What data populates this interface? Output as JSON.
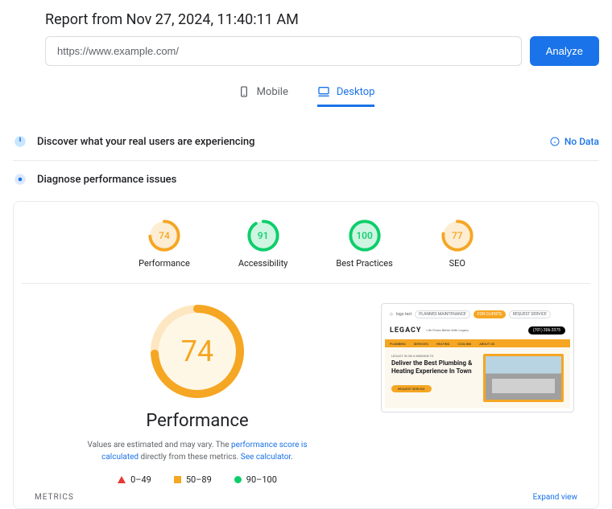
{
  "report_title": "Report from Nov 27, 2024, 11:40:11 AM",
  "url_value": "https://www.example.com/",
  "analyze_label": "Analyze",
  "tabs": {
    "mobile": "Mobile",
    "desktop": "Desktop"
  },
  "sections": {
    "discover": "Discover what your real users are experiencing",
    "no_data": "No Data",
    "diagnose": "Diagnose performance issues"
  },
  "scores": [
    {
      "value": 74,
      "label": "Performance",
      "color": "#f5a623"
    },
    {
      "value": 91,
      "label": "Accessibility",
      "color": "#0cce6b"
    },
    {
      "value": 100,
      "label": "Best Practices",
      "color": "#0cce6b"
    },
    {
      "value": 77,
      "label": "SEO",
      "color": "#f5a623"
    }
  ],
  "big_score": {
    "value": 74,
    "label": "Performance",
    "color": "#f5a623"
  },
  "desc": {
    "pre": "Values are estimated and may vary. The ",
    "link1": "performance score is calculated",
    "mid": " directly from these metrics. ",
    "link2": "See calculator."
  },
  "legend": {
    "r0": "0–49",
    "r1": "50–89",
    "r2": "90–100"
  },
  "preview": {
    "top_text": "logo text",
    "pills": [
      "PLANNED MAINTENANCE",
      "FOR CLIENTS",
      "REQUEST SERVICE"
    ],
    "phone": "(701) 306-3375",
    "logo": "LEGACY",
    "tagline": "Life Flows Better With Legacy",
    "nav": [
      "PLUMBING",
      "SERVICES",
      "HEATING",
      "COOLING",
      "ABOUT US"
    ],
    "mission": "LEGACY IS ON A MISSION TO",
    "headline": "Deliver the Best Plumbing & Heating Experience In Town",
    "cta": "REQUEST SERVICE"
  },
  "footer": {
    "metrics": "METRICS",
    "expand": "Expand view"
  }
}
